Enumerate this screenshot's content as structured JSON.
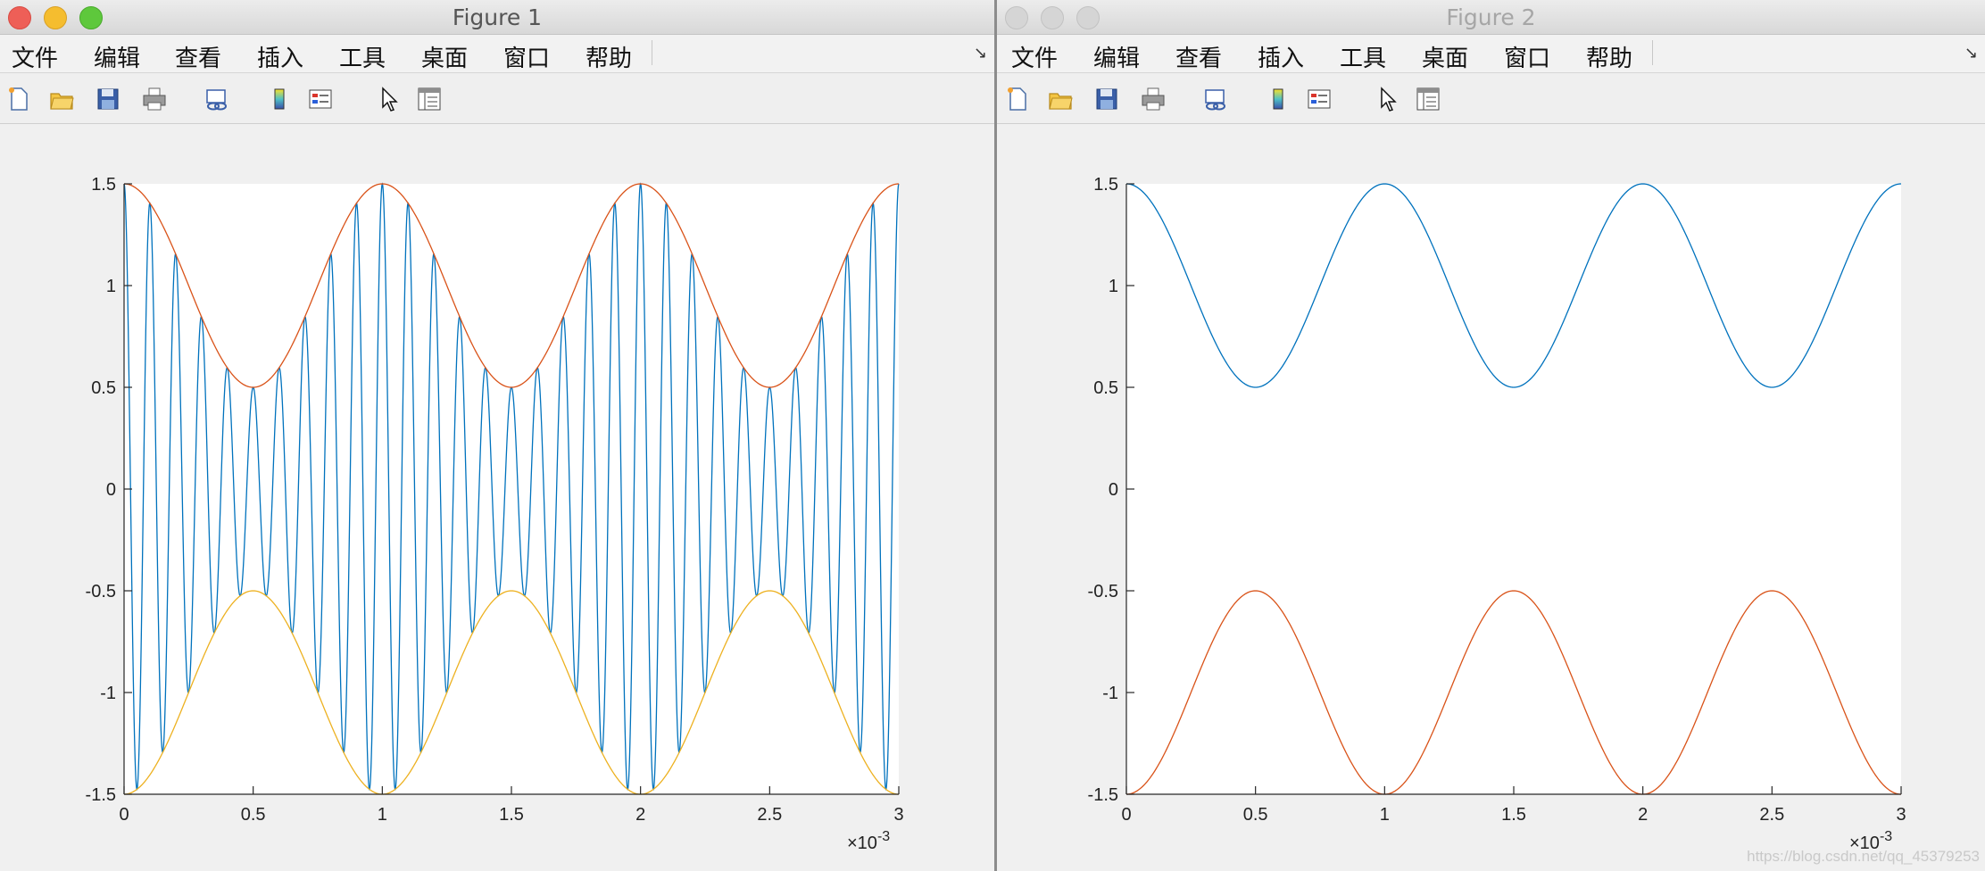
{
  "windows": [
    {
      "title": "Figure 1",
      "menu": [
        "文件",
        "编辑",
        "查看",
        "插入",
        "工具",
        "桌面",
        "窗口",
        "帮助"
      ]
    },
    {
      "title": "Figure 2",
      "menu": [
        "文件",
        "编辑",
        "查看",
        "插入",
        "工具",
        "桌面",
        "窗口",
        "帮助"
      ]
    }
  ],
  "toolbar_icons": [
    "new-figure-icon",
    "open-folder-icon",
    "save-icon",
    "print-icon",
    "link-plot-icon",
    "colorbar-icon",
    "legend-icon",
    "pointer-icon",
    "property-inspector-icon"
  ],
  "watermark": "https://blog.csdn.net/qq_45379253",
  "colors": {
    "blue": "#0072BD",
    "orange": "#D95319",
    "yellow": "#EDB120"
  },
  "chart_data": [
    {
      "type": "line",
      "xlim": [
        0,
        0.003
      ],
      "ylim": [
        -1.5,
        1.5
      ],
      "xticks": [
        "0",
        "0.5",
        "1",
        "1.5",
        "2",
        "2.5",
        "3"
      ],
      "yticks": [
        "-1.5",
        "-1",
        "-0.5",
        "0",
        "0.5",
        "1",
        "1.5"
      ],
      "x_multiplier": "×10",
      "x_exponent": "-3",
      "series": [
        {
          "formula": "y = (1 + 0.5*cos(2*pi*1000*t)) * cos(2*pi*10000*t)",
          "x_range": [
            0,
            0.003
          ],
          "color": "#0072BD"
        },
        {
          "formula": "y = 1 + 0.5*cos(2*pi*1000*t)",
          "x_range": [
            0,
            0.003
          ],
          "color": "#D95319"
        },
        {
          "formula": "y = -(1 + 0.5*cos(2*pi*1000*t))",
          "x_range": [
            0,
            0.003
          ],
          "color": "#EDB120"
        }
      ]
    },
    {
      "type": "line",
      "xlim": [
        0,
        0.003
      ],
      "ylim": [
        -1.5,
        1.5
      ],
      "xticks": [
        "0",
        "0.5",
        "1",
        "1.5",
        "2",
        "2.5",
        "3"
      ],
      "yticks": [
        "-1.5",
        "-1",
        "-0.5",
        "0",
        "0.5",
        "1",
        "1.5"
      ],
      "x_multiplier": "×10",
      "x_exponent": "-3",
      "series": [
        {
          "formula": "y = 1 + 0.5*cos(2*pi*1000*t)",
          "x_range": [
            0,
            0.003
          ],
          "color": "#0072BD"
        },
        {
          "formula": "y = -(1 + 0.5*cos(2*pi*1000*t))",
          "x_range": [
            0,
            0.003
          ],
          "color": "#D95319"
        }
      ]
    }
  ]
}
